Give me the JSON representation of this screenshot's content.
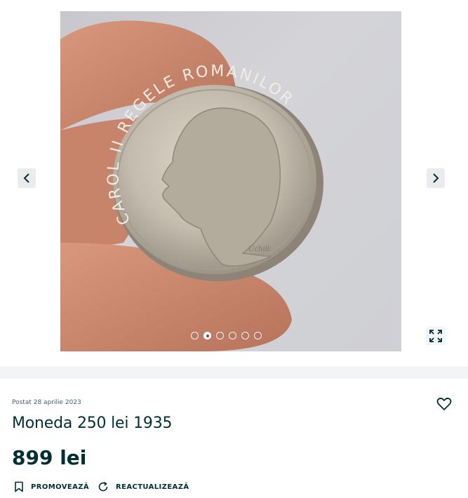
{
  "gallery": {
    "image_alt": "Moneda 250 lei 1935",
    "coin_legend": "CAROL II REGELE ROMANILOR",
    "coin_signature": "Uchill",
    "slides_total": 6,
    "active_slide": 2,
    "prev_icon": "chevron-left-icon",
    "next_icon": "chevron-right-icon",
    "fullscreen_icon": "expand-icon"
  },
  "listing": {
    "posted": "Postat 28 aprilie 2023",
    "title": "Moneda 250 lei 1935",
    "price": "899 lei",
    "favorite_icon": "heart-icon"
  },
  "actions": {
    "promote_label": "PROMOVEAZĂ",
    "promote_icon": "bookmark-icon",
    "refresh_label": "REACTUALIZEAZĂ",
    "refresh_icon": "refresh-icon"
  },
  "colors": {
    "text": "#002f34",
    "muted": "#406367",
    "divider": "#f2f4f5"
  }
}
